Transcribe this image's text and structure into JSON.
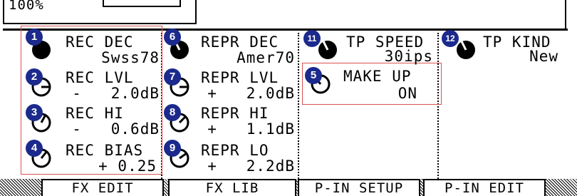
{
  "top": {
    "value": "100%"
  },
  "params": {
    "rec_dec": {
      "badge": "1",
      "label": "REC DEC",
      "value": "Swss78"
    },
    "rec_lvl": {
      "badge": "2",
      "label": "REC LVL",
      "value": "-   2.0dB"
    },
    "rec_hi": {
      "badge": "3",
      "label": "REC HI",
      "value": "-   0.6dB"
    },
    "rec_bias": {
      "badge": "4",
      "label": "REC BIAS",
      "value": "+ 0.25"
    },
    "make_up": {
      "badge": "5",
      "label": "MAKE UP",
      "value": "ON"
    },
    "repr_dec": {
      "badge": "6",
      "label": "REPR DEC",
      "value": "Amer70"
    },
    "repr_lvl": {
      "badge": "7",
      "label": "REPR LVL",
      "value": "+   2.0dB"
    },
    "repr_hi": {
      "badge": "8",
      "label": "REPR HI",
      "value": "+   1.1dB"
    },
    "repr_lo": {
      "badge": "9",
      "label": "REPR LO",
      "value": "+   2.2dB"
    },
    "tp_speed": {
      "badge": "11",
      "label": "TP SPEED",
      "value": "30ips"
    },
    "tp_kind": {
      "badge": "12",
      "label": "TP KIND",
      "value": "New"
    }
  },
  "tabs": {
    "fx_edit": "FX EDIT",
    "fx_lib": "FX LIB",
    "p_in_setup": "P-IN SETUP",
    "p_in_edit": "P-IN EDIT"
  },
  "colors": {
    "badge": "#1b2a8c",
    "highlight": "#d9534f"
  }
}
